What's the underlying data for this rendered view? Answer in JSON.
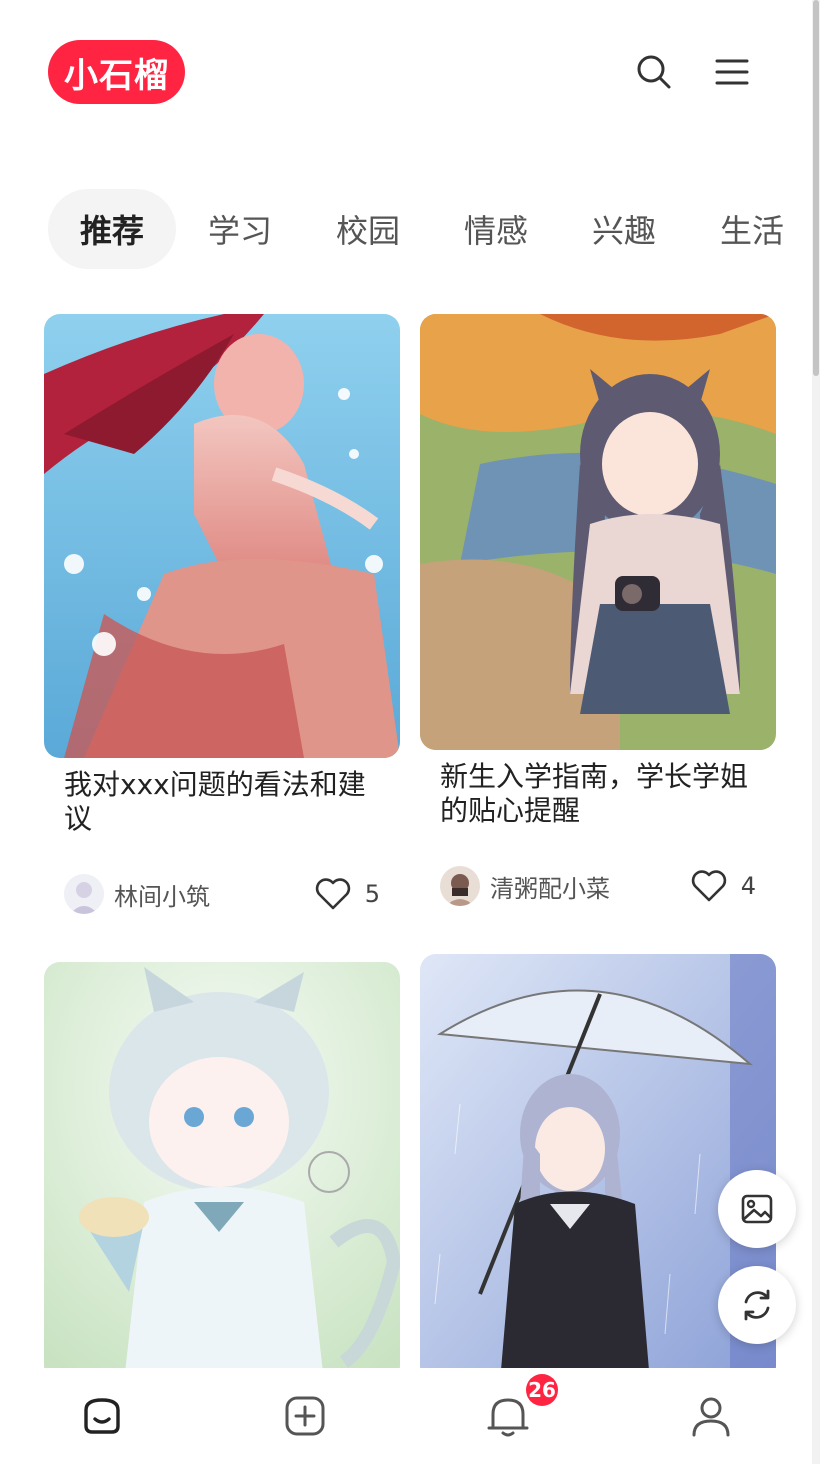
{
  "header": {
    "logo_text": "小石榴",
    "brand_color": "#ff2442",
    "search_icon": "search-icon",
    "menu_icon": "menu-icon"
  },
  "tabs": [
    {
      "label": "推荐",
      "active": true
    },
    {
      "label": "学习",
      "active": false
    },
    {
      "label": "校园",
      "active": false
    },
    {
      "label": "情感",
      "active": false
    },
    {
      "label": "兴趣",
      "active": false
    },
    {
      "label": "生活",
      "active": false
    }
  ],
  "feed": [
    {
      "title": "我对xxx问题的看法和建议",
      "author": "林间小筑",
      "likes": "5",
      "image": "illustration-girl-red-hair-flowers"
    },
    {
      "title": "新生入学指南，学长学姐的贴心提醒",
      "author": "清粥配小菜",
      "likes": "4",
      "image": "illustration-cat-girl-camera"
    },
    {
      "title": "",
      "author": "",
      "likes": "",
      "image": "illustration-cat-girl-icecream"
    },
    {
      "title": "",
      "author": "",
      "likes": "",
      "image": "illustration-girl-umbrella-rain"
    }
  ],
  "floating_buttons": [
    {
      "icon": "image-icon"
    },
    {
      "icon": "refresh-icon"
    }
  ],
  "bottom_nav": {
    "items": [
      {
        "icon": "home-icon",
        "active": true
      },
      {
        "icon": "add-post-icon",
        "active": false
      },
      {
        "icon": "bell-icon",
        "active": false
      },
      {
        "icon": "profile-icon",
        "active": false
      }
    ],
    "notification_count": "26"
  }
}
